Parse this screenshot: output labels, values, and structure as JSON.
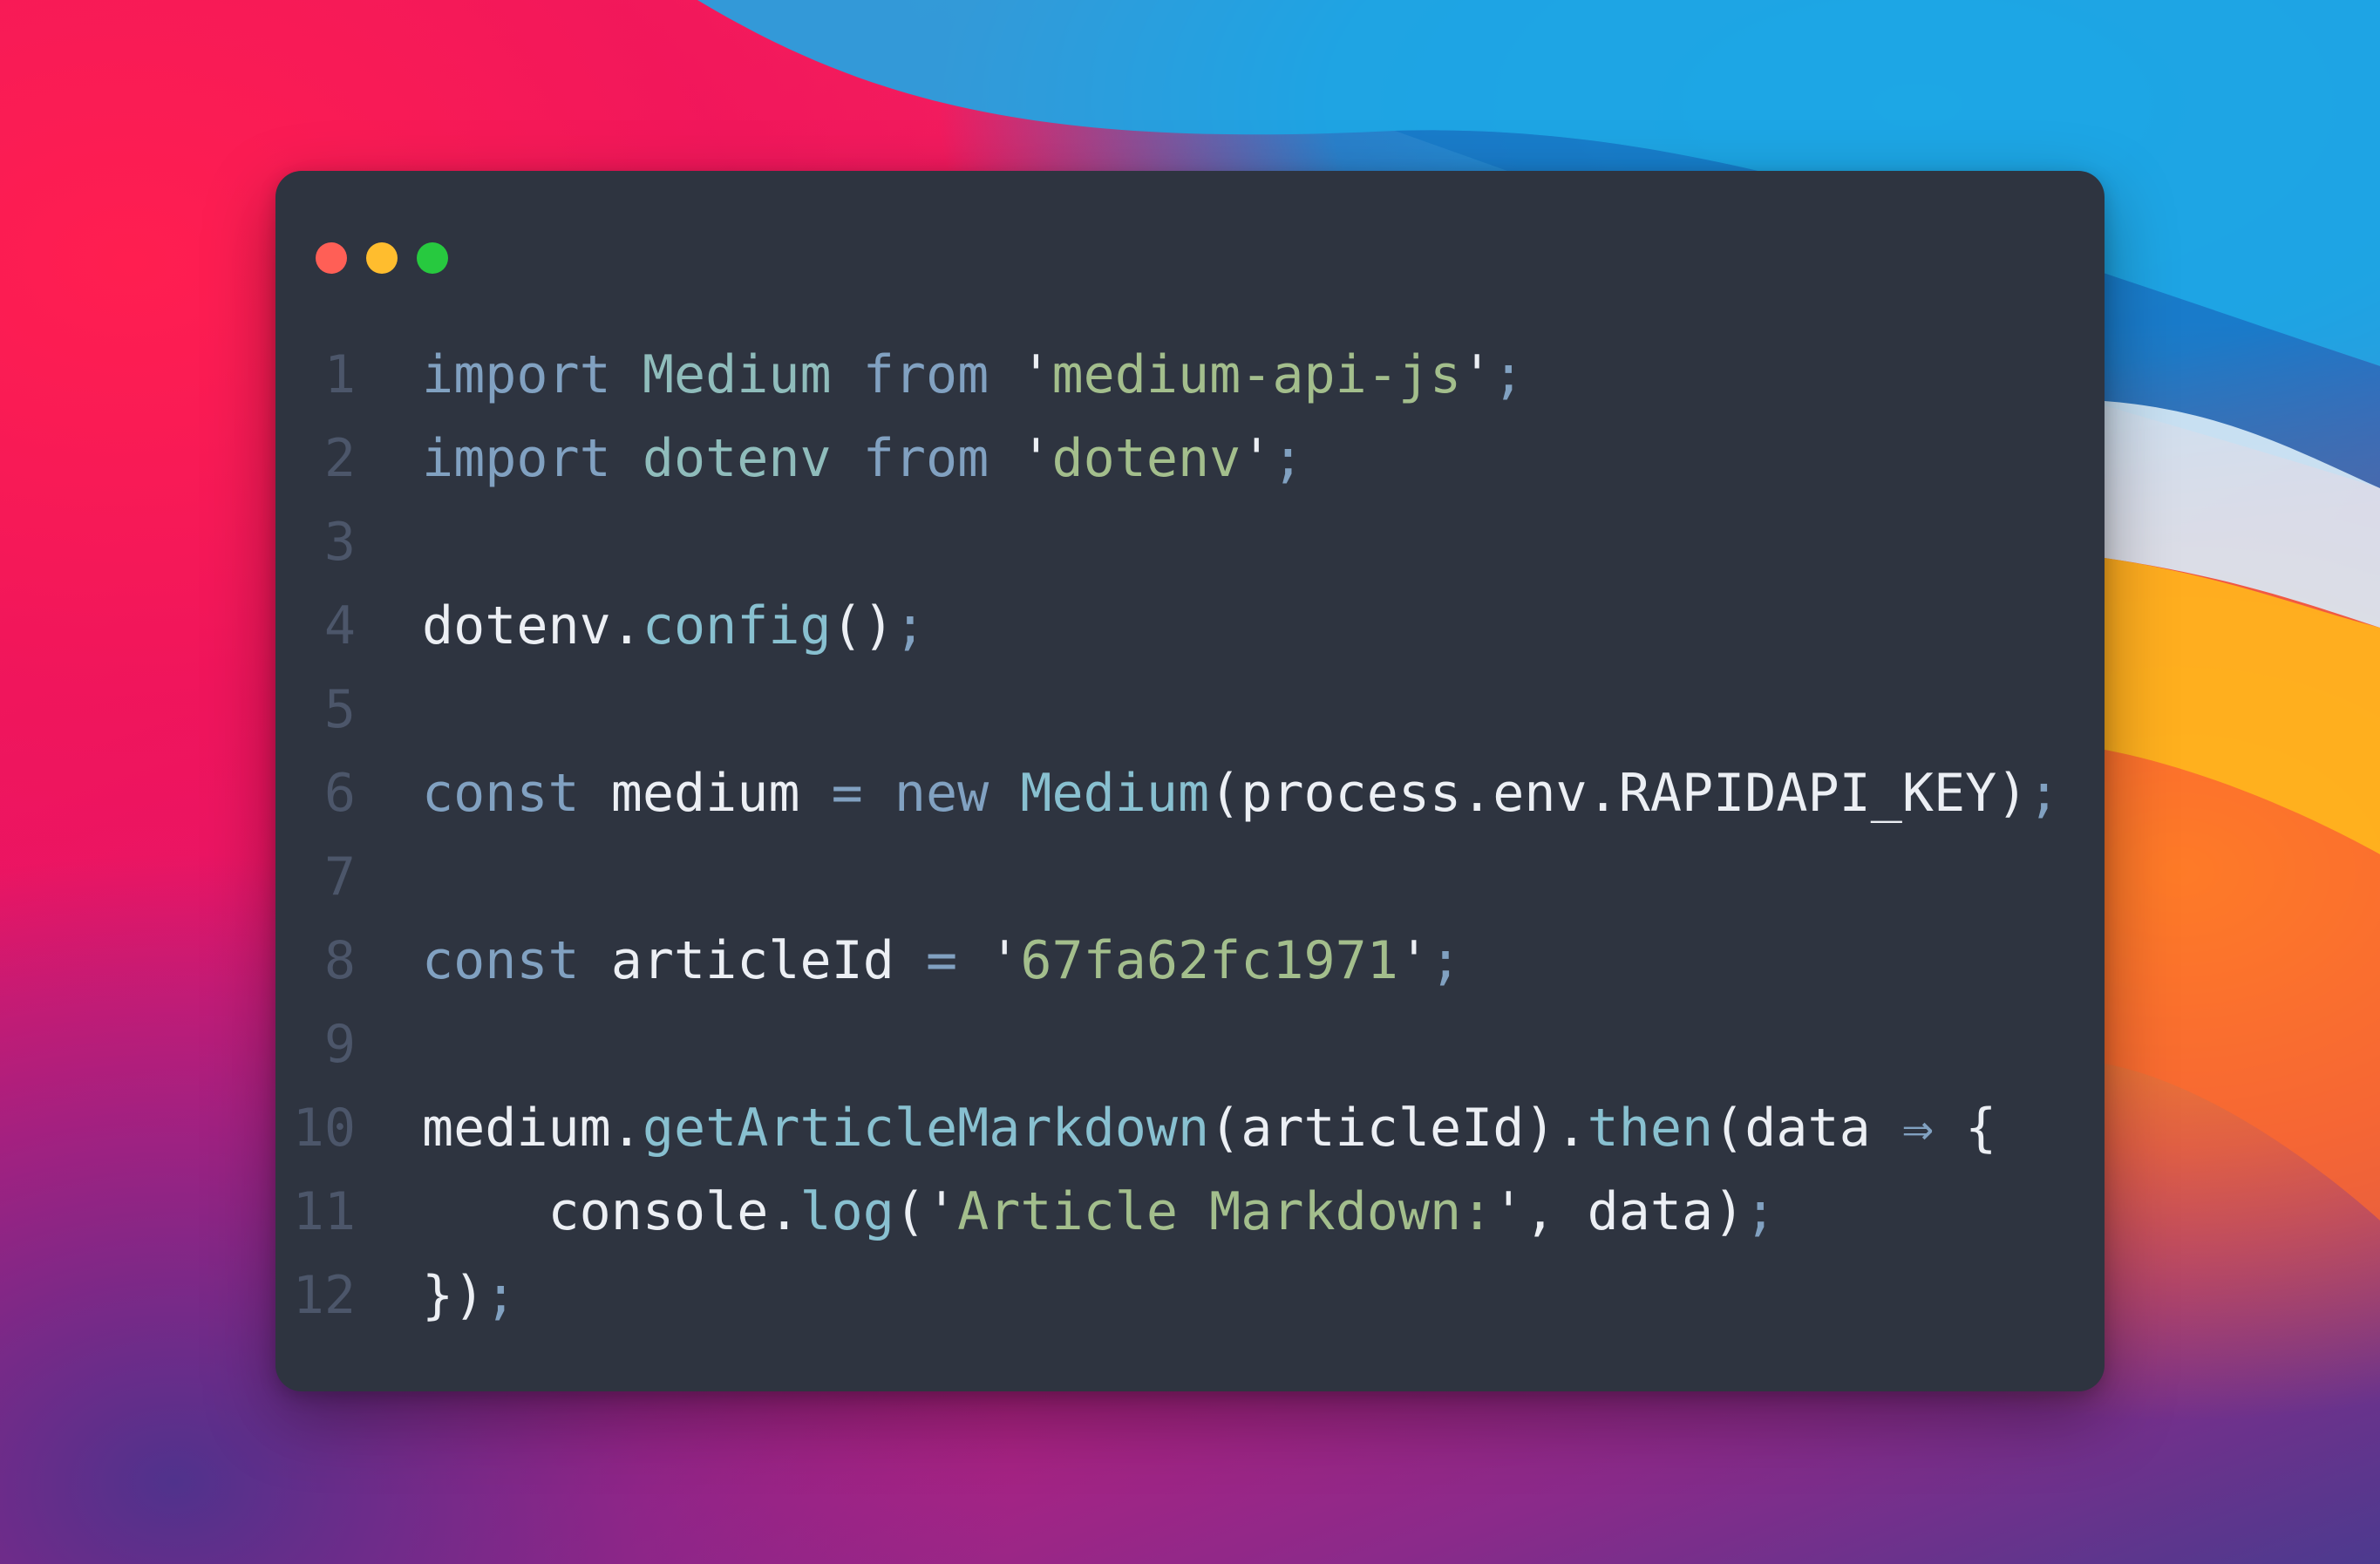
{
  "colors": {
    "window_bg": "#2e3440",
    "keyword": "#81a1c1",
    "function": "#88c0d0",
    "string": "#a3be8c",
    "identifier": "#8fbcbb",
    "text": "#eceff4",
    "line_number": "#4c566a",
    "traffic_red": "#ff5f56",
    "traffic_yellow": "#ffbd2e",
    "traffic_green": "#27c93f"
  },
  "window": {
    "controls": [
      "close-dot",
      "minimize-dot",
      "maximize-dot"
    ]
  },
  "code": {
    "lines": [
      {
        "number": "1",
        "tokens": [
          {
            "t": "import",
            "c": "kw"
          },
          {
            "t": " ",
            "c": "punc"
          },
          {
            "t": "Medium",
            "c": "id"
          },
          {
            "t": " ",
            "c": "punc"
          },
          {
            "t": "from",
            "c": "kw"
          },
          {
            "t": " ",
            "c": "punc"
          },
          {
            "t": "'",
            "c": "punc"
          },
          {
            "t": "medium-api-js",
            "c": "str"
          },
          {
            "t": "'",
            "c": "punc"
          },
          {
            "t": ";",
            "c": "semi"
          }
        ]
      },
      {
        "number": "2",
        "tokens": [
          {
            "t": "import",
            "c": "kw"
          },
          {
            "t": " ",
            "c": "punc"
          },
          {
            "t": "dotenv",
            "c": "id"
          },
          {
            "t": " ",
            "c": "punc"
          },
          {
            "t": "from",
            "c": "kw"
          },
          {
            "t": " ",
            "c": "punc"
          },
          {
            "t": "'",
            "c": "punc"
          },
          {
            "t": "dotenv",
            "c": "str"
          },
          {
            "t": "'",
            "c": "punc"
          },
          {
            "t": ";",
            "c": "semi"
          }
        ]
      },
      {
        "number": "3",
        "tokens": []
      },
      {
        "number": "4",
        "tokens": [
          {
            "t": "dotenv",
            "c": "punc"
          },
          {
            "t": ".",
            "c": "punc"
          },
          {
            "t": "config",
            "c": "fn"
          },
          {
            "t": "()",
            "c": "punc"
          },
          {
            "t": ";",
            "c": "semi"
          }
        ]
      },
      {
        "number": "5",
        "tokens": []
      },
      {
        "number": "6",
        "tokens": [
          {
            "t": "const",
            "c": "kw"
          },
          {
            "t": " medium ",
            "c": "punc"
          },
          {
            "t": "=",
            "c": "op"
          },
          {
            "t": " ",
            "c": "punc"
          },
          {
            "t": "new",
            "c": "kw"
          },
          {
            "t": " ",
            "c": "punc"
          },
          {
            "t": "Medium",
            "c": "fn"
          },
          {
            "t": "(process.env.RAPIDAPI_KEY)",
            "c": "punc"
          },
          {
            "t": ";",
            "c": "semi"
          }
        ]
      },
      {
        "number": "7",
        "tokens": []
      },
      {
        "number": "8",
        "tokens": [
          {
            "t": "const",
            "c": "kw"
          },
          {
            "t": " articleId ",
            "c": "punc"
          },
          {
            "t": "=",
            "c": "op"
          },
          {
            "t": " ",
            "c": "punc"
          },
          {
            "t": "'",
            "c": "punc"
          },
          {
            "t": "67fa62fc1971",
            "c": "str"
          },
          {
            "t": "'",
            "c": "punc"
          },
          {
            "t": ";",
            "c": "semi"
          }
        ]
      },
      {
        "number": "9",
        "tokens": []
      },
      {
        "number": "10",
        "tokens": [
          {
            "t": "medium",
            "c": "punc"
          },
          {
            "t": ".",
            "c": "punc"
          },
          {
            "t": "getArticleMarkdown",
            "c": "fn"
          },
          {
            "t": "(articleId).",
            "c": "punc"
          },
          {
            "t": "then",
            "c": "fn"
          },
          {
            "t": "(data ",
            "c": "punc"
          },
          {
            "t": "⇒",
            "c": "op"
          },
          {
            "t": " {",
            "c": "punc"
          }
        ]
      },
      {
        "number": "11",
        "tokens": [
          {
            "t": "    console",
            "c": "punc"
          },
          {
            "t": ".",
            "c": "punc"
          },
          {
            "t": "log",
            "c": "fn"
          },
          {
            "t": "(",
            "c": "punc"
          },
          {
            "t": "'",
            "c": "punc"
          },
          {
            "t": "Article Markdown:",
            "c": "str"
          },
          {
            "t": "'",
            "c": "punc"
          },
          {
            "t": ", data)",
            "c": "punc"
          },
          {
            "t": ";",
            "c": "semi"
          }
        ]
      },
      {
        "number": "12",
        "tokens": [
          {
            "t": "})",
            "c": "punc"
          },
          {
            "t": ";",
            "c": "semi"
          }
        ]
      }
    ]
  }
}
